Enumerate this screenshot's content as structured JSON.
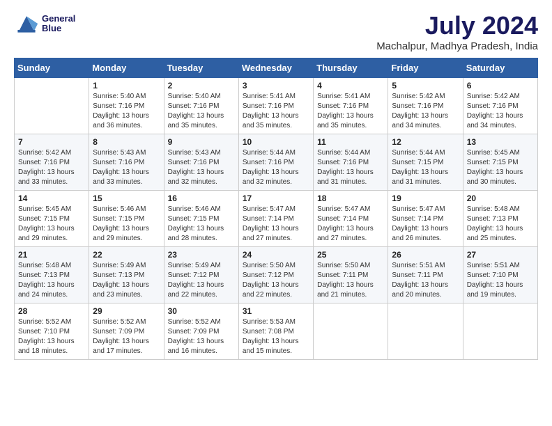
{
  "header": {
    "logo_line1": "General",
    "logo_line2": "Blue",
    "title": "July 2024",
    "subtitle": "Machalpur, Madhya Pradesh, India"
  },
  "weekdays": [
    "Sunday",
    "Monday",
    "Tuesday",
    "Wednesday",
    "Thursday",
    "Friday",
    "Saturday"
  ],
  "weeks": [
    [
      {
        "day": "",
        "info": ""
      },
      {
        "day": "1",
        "info": "Sunrise: 5:40 AM\nSunset: 7:16 PM\nDaylight: 13 hours\nand 36 minutes."
      },
      {
        "day": "2",
        "info": "Sunrise: 5:40 AM\nSunset: 7:16 PM\nDaylight: 13 hours\nand 35 minutes."
      },
      {
        "day": "3",
        "info": "Sunrise: 5:41 AM\nSunset: 7:16 PM\nDaylight: 13 hours\nand 35 minutes."
      },
      {
        "day": "4",
        "info": "Sunrise: 5:41 AM\nSunset: 7:16 PM\nDaylight: 13 hours\nand 35 minutes."
      },
      {
        "day": "5",
        "info": "Sunrise: 5:42 AM\nSunset: 7:16 PM\nDaylight: 13 hours\nand 34 minutes."
      },
      {
        "day": "6",
        "info": "Sunrise: 5:42 AM\nSunset: 7:16 PM\nDaylight: 13 hours\nand 34 minutes."
      }
    ],
    [
      {
        "day": "7",
        "info": "Sunrise: 5:42 AM\nSunset: 7:16 PM\nDaylight: 13 hours\nand 33 minutes."
      },
      {
        "day": "8",
        "info": "Sunrise: 5:43 AM\nSunset: 7:16 PM\nDaylight: 13 hours\nand 33 minutes."
      },
      {
        "day": "9",
        "info": "Sunrise: 5:43 AM\nSunset: 7:16 PM\nDaylight: 13 hours\nand 32 minutes."
      },
      {
        "day": "10",
        "info": "Sunrise: 5:44 AM\nSunset: 7:16 PM\nDaylight: 13 hours\nand 32 minutes."
      },
      {
        "day": "11",
        "info": "Sunrise: 5:44 AM\nSunset: 7:16 PM\nDaylight: 13 hours\nand 31 minutes."
      },
      {
        "day": "12",
        "info": "Sunrise: 5:44 AM\nSunset: 7:15 PM\nDaylight: 13 hours\nand 31 minutes."
      },
      {
        "day": "13",
        "info": "Sunrise: 5:45 AM\nSunset: 7:15 PM\nDaylight: 13 hours\nand 30 minutes."
      }
    ],
    [
      {
        "day": "14",
        "info": "Sunrise: 5:45 AM\nSunset: 7:15 PM\nDaylight: 13 hours\nand 29 minutes."
      },
      {
        "day": "15",
        "info": "Sunrise: 5:46 AM\nSunset: 7:15 PM\nDaylight: 13 hours\nand 29 minutes."
      },
      {
        "day": "16",
        "info": "Sunrise: 5:46 AM\nSunset: 7:15 PM\nDaylight: 13 hours\nand 28 minutes."
      },
      {
        "day": "17",
        "info": "Sunrise: 5:47 AM\nSunset: 7:14 PM\nDaylight: 13 hours\nand 27 minutes."
      },
      {
        "day": "18",
        "info": "Sunrise: 5:47 AM\nSunset: 7:14 PM\nDaylight: 13 hours\nand 27 minutes."
      },
      {
        "day": "19",
        "info": "Sunrise: 5:47 AM\nSunset: 7:14 PM\nDaylight: 13 hours\nand 26 minutes."
      },
      {
        "day": "20",
        "info": "Sunrise: 5:48 AM\nSunset: 7:13 PM\nDaylight: 13 hours\nand 25 minutes."
      }
    ],
    [
      {
        "day": "21",
        "info": "Sunrise: 5:48 AM\nSunset: 7:13 PM\nDaylight: 13 hours\nand 24 minutes."
      },
      {
        "day": "22",
        "info": "Sunrise: 5:49 AM\nSunset: 7:13 PM\nDaylight: 13 hours\nand 23 minutes."
      },
      {
        "day": "23",
        "info": "Sunrise: 5:49 AM\nSunset: 7:12 PM\nDaylight: 13 hours\nand 22 minutes."
      },
      {
        "day": "24",
        "info": "Sunrise: 5:50 AM\nSunset: 7:12 PM\nDaylight: 13 hours\nand 22 minutes."
      },
      {
        "day": "25",
        "info": "Sunrise: 5:50 AM\nSunset: 7:11 PM\nDaylight: 13 hours\nand 21 minutes."
      },
      {
        "day": "26",
        "info": "Sunrise: 5:51 AM\nSunset: 7:11 PM\nDaylight: 13 hours\nand 20 minutes."
      },
      {
        "day": "27",
        "info": "Sunrise: 5:51 AM\nSunset: 7:10 PM\nDaylight: 13 hours\nand 19 minutes."
      }
    ],
    [
      {
        "day": "28",
        "info": "Sunrise: 5:52 AM\nSunset: 7:10 PM\nDaylight: 13 hours\nand 18 minutes."
      },
      {
        "day": "29",
        "info": "Sunrise: 5:52 AM\nSunset: 7:09 PM\nDaylight: 13 hours\nand 17 minutes."
      },
      {
        "day": "30",
        "info": "Sunrise: 5:52 AM\nSunset: 7:09 PM\nDaylight: 13 hours\nand 16 minutes."
      },
      {
        "day": "31",
        "info": "Sunrise: 5:53 AM\nSunset: 7:08 PM\nDaylight: 13 hours\nand 15 minutes."
      },
      {
        "day": "",
        "info": ""
      },
      {
        "day": "",
        "info": ""
      },
      {
        "day": "",
        "info": ""
      }
    ]
  ]
}
